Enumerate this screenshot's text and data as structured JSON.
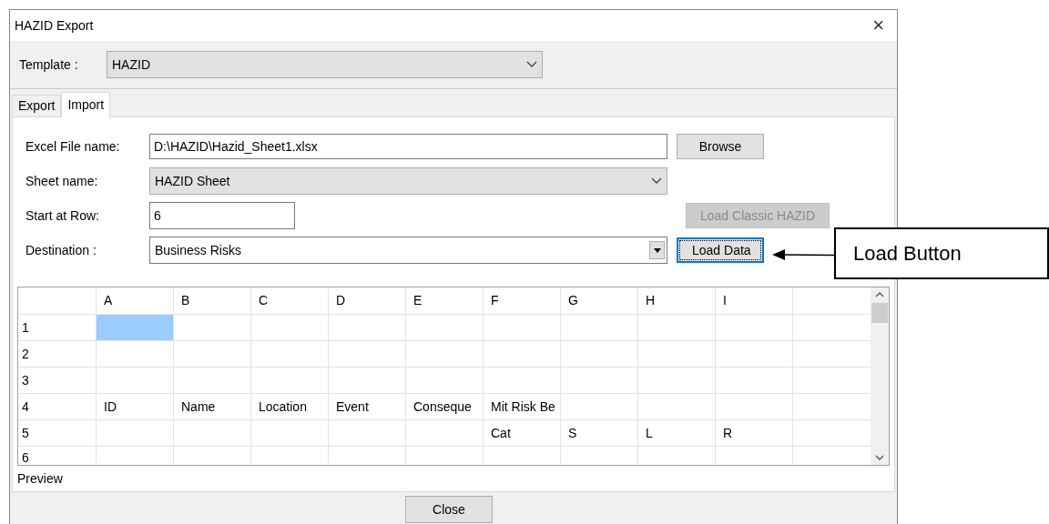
{
  "window": {
    "title": "HAZID Export",
    "close": "×"
  },
  "template": {
    "label": "Template :",
    "value": "HAZID"
  },
  "tabs": [
    {
      "label": "Export",
      "selected": false
    },
    {
      "label": "Import",
      "selected": true
    }
  ],
  "fields": [
    {
      "label": "Excel File name:",
      "kind": "text",
      "value": "D:\\HAZID\\Hazid_Sheet1.xlsx",
      "button": {
        "label": "Browse",
        "disabled": false,
        "focused": false
      }
    },
    {
      "label": "Sheet name:",
      "kind": "dropdown",
      "value": "HAZID Sheet"
    },
    {
      "label": "Start at Row:",
      "kind": "short",
      "value": "6",
      "button": {
        "label": "Load Classic HAZID",
        "disabled": true,
        "focused": false
      }
    },
    {
      "label": "Destination :",
      "kind": "combo",
      "value": "Business Risks",
      "button": {
        "label": "Load Data",
        "disabled": false,
        "focused": true
      }
    }
  ],
  "grid": {
    "columns": [
      "A",
      "B",
      "C",
      "D",
      "E",
      "F",
      "G",
      "H",
      "I"
    ],
    "rows": [
      {
        "label": "1",
        "cells": [
          {
            "selected": true
          },
          {
            "selected": false
          },
          {
            "selected": false
          },
          {
            "selected": false
          },
          {
            "selected": false
          },
          {
            "selected": false
          },
          {
            "selected": false
          },
          {
            "selected": false
          },
          {
            "selected": false
          }
        ]
      },
      {
        "label": "2",
        "cells": [
          {
            "selected": false
          },
          {
            "selected": false
          },
          {
            "selected": false
          },
          {
            "selected": false
          },
          {
            "selected": false
          },
          {
            "selected": false
          },
          {
            "selected": false
          },
          {
            "selected": false
          },
          {
            "selected": false
          }
        ]
      },
      {
        "label": "3",
        "cells": [
          {
            "selected": false
          },
          {
            "selected": false
          },
          {
            "selected": false
          },
          {
            "selected": false
          },
          {
            "selected": false
          },
          {
            "selected": false
          },
          {
            "selected": false
          },
          {
            "selected": false
          },
          {
            "selected": false
          }
        ]
      },
      {
        "label": "4",
        "cells": [
          {
            "text": "ID",
            "selected": false
          },
          {
            "text": "Name",
            "selected": false
          },
          {
            "text": "Location",
            "selected": false
          },
          {
            "text": "Event",
            "selected": false
          },
          {
            "text": "Conseque",
            "selected": false
          },
          {
            "text": "Mit Risk Be",
            "selected": false
          },
          {
            "selected": false
          },
          {
            "selected": false
          },
          {
            "selected": false
          }
        ]
      },
      {
        "label": "5",
        "cells": [
          {
            "selected": false
          },
          {
            "selected": false
          },
          {
            "selected": false
          },
          {
            "selected": false
          },
          {
            "selected": false
          },
          {
            "text": "Cat",
            "selected": false
          },
          {
            "text": "S",
            "selected": false
          },
          {
            "text": "L",
            "selected": false
          },
          {
            "text": "R",
            "selected": false
          }
        ]
      },
      {
        "label": "6",
        "cells": [
          {
            "selected": false
          },
          {
            "selected": false
          },
          {
            "selected": false
          },
          {
            "selected": false
          },
          {
            "selected": false
          },
          {
            "selected": false
          },
          {
            "selected": false
          },
          {
            "selected": false
          },
          {
            "selected": false
          }
        ]
      }
    ]
  },
  "preview_label": "Preview",
  "close_button": "Close",
  "callout": {
    "text": "Load Button"
  }
}
